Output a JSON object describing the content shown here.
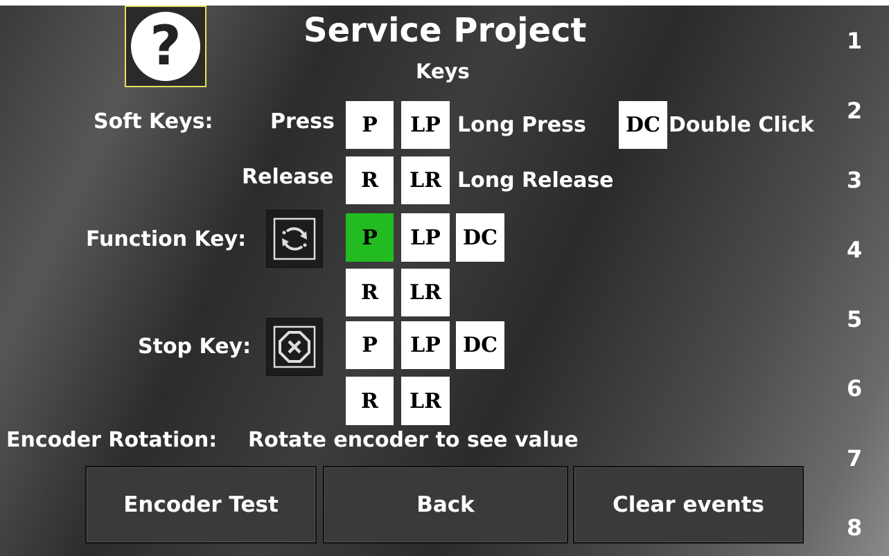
{
  "title": "Service Project",
  "subtitle": "Keys",
  "help_icon": "question-mark-icon",
  "soft_keys": {
    "label": "Soft Keys:",
    "press_label": "Press",
    "release_label": "Release",
    "p": "P",
    "lp": "LP",
    "dc": "DC",
    "r": "R",
    "lr": "LR",
    "long_press_text": "Long Press",
    "double_click_text": "Double Click",
    "long_release_text": "Long Release"
  },
  "function_key": {
    "label": "Function Key:",
    "icon": "rotate-arrows-icon",
    "p": "P",
    "lp": "LP",
    "dc": "DC",
    "r": "R",
    "lr": "LR",
    "active": "P",
    "active_color": "#22bb22"
  },
  "stop_key": {
    "label": "Stop Key:",
    "icon": "stop-x-icon",
    "p": "P",
    "lp": "LP",
    "dc": "DC",
    "r": "R",
    "lr": "LR"
  },
  "encoder": {
    "label": "Encoder Rotation:",
    "value": "Rotate encoder to see value"
  },
  "buttons": {
    "encoder_test": "Encoder Test",
    "back": "Back",
    "clear_events": "Clear events"
  },
  "side_numbers": [
    "1",
    "2",
    "3",
    "4",
    "5",
    "6",
    "7",
    "8"
  ]
}
